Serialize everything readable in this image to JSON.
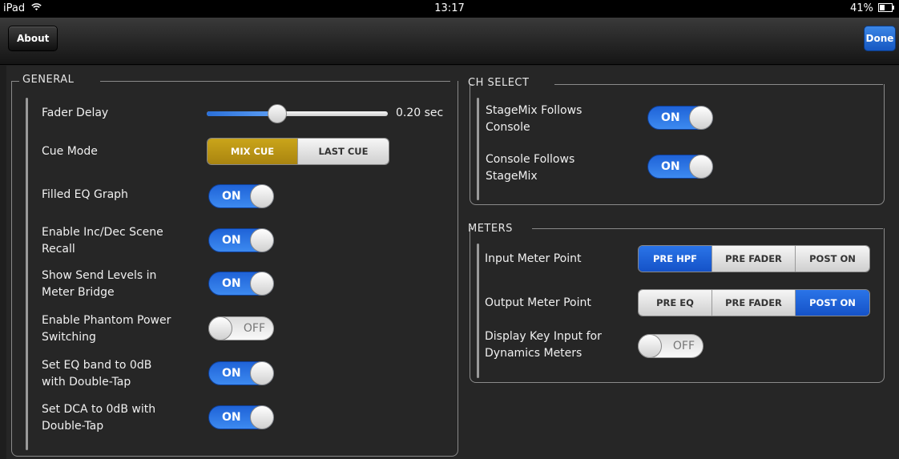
{
  "status_bar": {
    "device": "iPad",
    "time": "13:17",
    "battery": "41%",
    "battery_level": 0.41
  },
  "nav": {
    "about_label": "About",
    "done_label": "Done"
  },
  "general": {
    "title": "GENERAL",
    "fader_delay": {
      "label": "Fader Delay",
      "value_text": "0.20 sec",
      "fraction": 0.39
    },
    "cue_mode": {
      "label": "Cue Mode",
      "options": [
        "MIX CUE",
        "LAST CUE"
      ],
      "selected": "MIX CUE"
    },
    "filled_eq": {
      "label": "Filled EQ Graph",
      "state": "ON"
    },
    "inc_dec": {
      "label_1": "Enable Inc/Dec Scene",
      "label_2": "Recall",
      "state": "ON"
    },
    "send_levels": {
      "label_1": "Show Send Levels in",
      "label_2": "Meter Bridge",
      "state": "ON"
    },
    "phantom": {
      "label_1": "Enable Phantom Power",
      "label_2": "Switching",
      "state": "OFF"
    },
    "eq_band": {
      "label_1": "Set EQ band to 0dB",
      "label_2": "with Double-Tap",
      "state": "ON"
    },
    "dca": {
      "label_1": "Set DCA to 0dB with",
      "label_2": "Double-Tap",
      "state": "ON"
    }
  },
  "ch_select": {
    "title": "CH SELECT",
    "follows_console": {
      "label_1": "StageMix Follows",
      "label_2": "Console",
      "state": "ON"
    },
    "console_follows": {
      "label_1": "Console Follows",
      "label_2": "StageMix",
      "state": "ON"
    }
  },
  "meters": {
    "title": "METERS",
    "input_point": {
      "label": "Input Meter Point",
      "options": [
        "PRE HPF",
        "PRE FADER",
        "POST ON"
      ],
      "selected": "PRE HPF"
    },
    "output_point": {
      "label": "Output Meter Point",
      "options": [
        "PRE EQ",
        "PRE FADER",
        "POST ON"
      ],
      "selected": "POST ON"
    },
    "key_input": {
      "label_1": "Display Key Input for",
      "label_2": "Dynamics Meters",
      "state": "OFF"
    }
  },
  "colors": {
    "toggle_on": "#2f78e6",
    "cue_selected": "#b8940f",
    "segment_selected": "#1e62d8",
    "done_button": "#2a70dc"
  }
}
